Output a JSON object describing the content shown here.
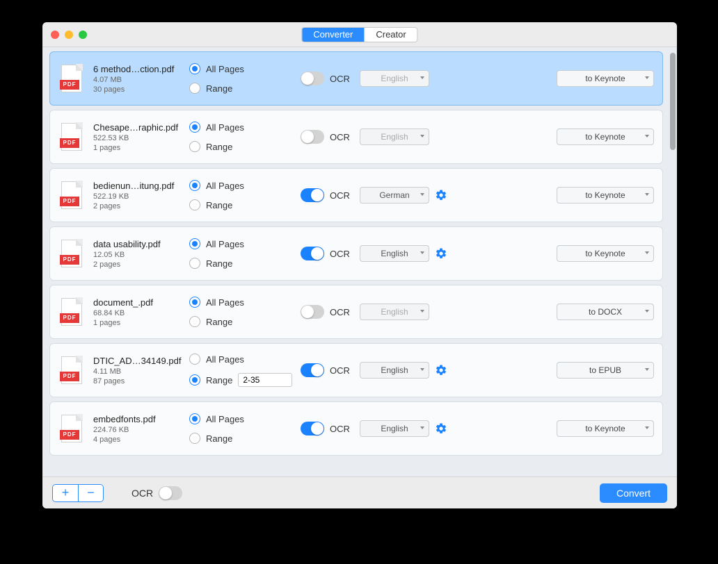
{
  "tabs": {
    "converter": "Converter",
    "creator": "Creator"
  },
  "labels": {
    "allPages": "All Pages",
    "range": "Range",
    "ocr": "OCR",
    "pdf": "PDF"
  },
  "footer": {
    "ocr": "OCR",
    "convert": "Convert",
    "plus": "+",
    "minus": "−"
  },
  "files": [
    {
      "name": "6 method…ction.pdf",
      "size": "4.07 MB",
      "pages": "30 pages",
      "selected": true,
      "pageMode": "all",
      "rangeValue": "",
      "ocrOn": false,
      "lang": "English",
      "showGear": false,
      "format": "to Keynote"
    },
    {
      "name": "Chesape…raphic.pdf",
      "size": "522.53 KB",
      "pages": "1 pages",
      "selected": false,
      "pageMode": "all",
      "rangeValue": "",
      "ocrOn": false,
      "lang": "English",
      "showGear": false,
      "format": "to Keynote"
    },
    {
      "name": "bedienun…itung.pdf",
      "size": "522.19 KB",
      "pages": "2 pages",
      "selected": false,
      "pageMode": "all",
      "rangeValue": "",
      "ocrOn": true,
      "lang": "German",
      "showGear": true,
      "format": "to Keynote"
    },
    {
      "name": "data usability.pdf",
      "size": "12.05 KB",
      "pages": "2 pages",
      "selected": false,
      "pageMode": "all",
      "rangeValue": "",
      "ocrOn": true,
      "lang": "English",
      "showGear": true,
      "format": "to Keynote"
    },
    {
      "name": "document_.pdf",
      "size": "68.84 KB",
      "pages": "1 pages",
      "selected": false,
      "pageMode": "all",
      "rangeValue": "",
      "ocrOn": false,
      "lang": "English",
      "showGear": false,
      "format": "to DOCX"
    },
    {
      "name": "DTIC_AD…34149.pdf",
      "size": "4.11 MB",
      "pages": "87 pages",
      "selected": false,
      "pageMode": "range",
      "rangeValue": "2-35",
      "ocrOn": true,
      "lang": "English",
      "showGear": true,
      "format": "to EPUB"
    },
    {
      "name": "embedfonts.pdf",
      "size": "224.76 KB",
      "pages": "4 pages",
      "selected": false,
      "pageMode": "all",
      "rangeValue": "",
      "ocrOn": true,
      "lang": "English",
      "showGear": true,
      "format": "to Keynote"
    }
  ]
}
